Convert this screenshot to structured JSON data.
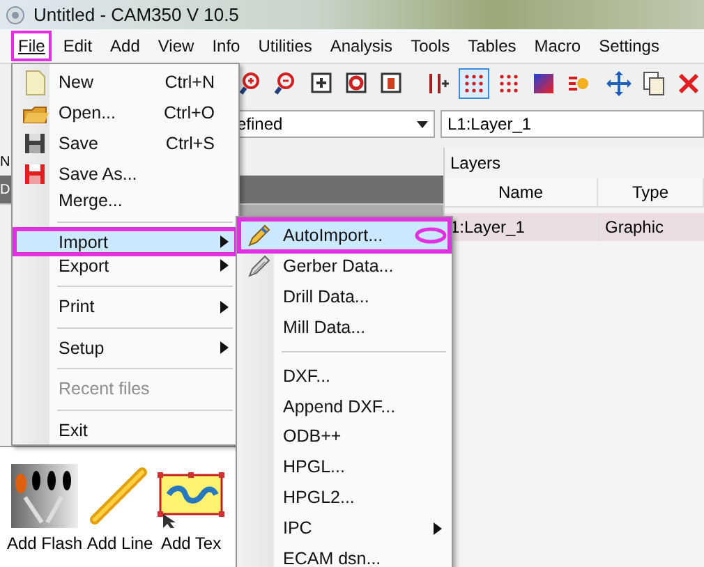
{
  "window": {
    "title": "Untitled - CAM350 V 10.5"
  },
  "menubar": [
    {
      "label": "File",
      "selected": true,
      "highlighted": true
    },
    {
      "label": "Edit",
      "selected": false,
      "highlighted": false
    },
    {
      "label": "Add",
      "selected": false,
      "highlighted": false
    },
    {
      "label": "View",
      "selected": false,
      "highlighted": false
    },
    {
      "label": "Info",
      "selected": false,
      "highlighted": false
    },
    {
      "label": "Utilities",
      "selected": false,
      "highlighted": false
    },
    {
      "label": "Analysis",
      "selected": false,
      "highlighted": false
    },
    {
      "label": "Tools",
      "selected": false,
      "highlighted": false
    },
    {
      "label": "Tables",
      "selected": false,
      "highlighted": false
    },
    {
      "label": "Macro",
      "selected": false,
      "highlighted": false
    },
    {
      "label": "Settings",
      "selected": false,
      "highlighted": false
    }
  ],
  "toolbar": [
    {
      "kind": "zoom-in",
      "selected": false
    },
    {
      "kind": "zoom-out",
      "selected": false
    },
    {
      "kind": "zoom-box",
      "selected": false
    },
    {
      "kind": "zoom-red",
      "selected": false
    },
    {
      "kind": "zoom-page",
      "selected": false
    },
    {
      "kind": "separator"
    },
    {
      "kind": "snap",
      "selected": false
    },
    {
      "kind": "grid",
      "selected": true
    },
    {
      "kind": "grid",
      "selected": false
    },
    {
      "kind": "color",
      "selected": false
    },
    {
      "kind": "dots",
      "selected": false
    },
    {
      "kind": "gap"
    },
    {
      "kind": "move",
      "selected": false
    },
    {
      "kind": "copy",
      "selected": false
    },
    {
      "kind": "delete",
      "selected": false
    }
  ],
  "layer_combo": {
    "value": "efined"
  },
  "layer_select": {
    "value": "L1:Layer_1"
  },
  "left_panel": {
    "label": "N",
    "header": "D"
  },
  "layers": {
    "title": "Layers",
    "columns": [
      "Name",
      "Type"
    ],
    "rows": [
      {
        "name": "1:Layer_1",
        "type": "Graphic",
        "selected": true
      }
    ]
  },
  "file_menu": [
    {
      "kind": "item",
      "label": "New",
      "shortcut": "Ctrl+N",
      "disabled": false,
      "selected": false,
      "submenu": false,
      "highlighted": false
    },
    {
      "kind": "item",
      "label": "Open...",
      "shortcut": "Ctrl+O",
      "disabled": false,
      "selected": false,
      "submenu": false,
      "highlighted": false
    },
    {
      "kind": "item",
      "label": "Save",
      "shortcut": "Ctrl+S",
      "disabled": false,
      "selected": false,
      "submenu": false,
      "highlighted": false
    },
    {
      "kind": "item",
      "label": "Save As...",
      "disabled": false,
      "selected": false,
      "submenu": false,
      "highlighted": false
    },
    {
      "kind": "item",
      "label": "Merge...",
      "disabled": false,
      "selected": false,
      "submenu": false,
      "highlighted": false
    },
    {
      "kind": "separator"
    },
    {
      "kind": "item",
      "label": "Import",
      "disabled": false,
      "selected": true,
      "submenu": true,
      "highlighted": true
    },
    {
      "kind": "item",
      "label": "Export",
      "disabled": false,
      "selected": false,
      "submenu": true,
      "highlighted": false
    },
    {
      "kind": "separator"
    },
    {
      "kind": "item",
      "label": "Print",
      "disabled": false,
      "selected": false,
      "submenu": true,
      "highlighted": false
    },
    {
      "kind": "separator"
    },
    {
      "kind": "item",
      "label": "Setup",
      "disabled": false,
      "selected": false,
      "submenu": true,
      "highlighted": false
    },
    {
      "kind": "separator"
    },
    {
      "kind": "item",
      "label": "Recent files",
      "disabled": true,
      "selected": false,
      "submenu": false,
      "highlighted": false
    },
    {
      "kind": "separator"
    },
    {
      "kind": "item",
      "label": "Exit",
      "disabled": false,
      "selected": false,
      "submenu": false,
      "highlighted": false
    }
  ],
  "import_menu": [
    {
      "kind": "item",
      "label": "AutoImport...",
      "disabled": false,
      "selected": true,
      "submenu": false,
      "highlighted": true
    },
    {
      "kind": "item",
      "label": "Gerber Data...",
      "disabled": false,
      "selected": false,
      "submenu": false,
      "highlighted": false
    },
    {
      "kind": "item",
      "label": "Drill Data...",
      "disabled": false,
      "selected": false,
      "submenu": false,
      "highlighted": false
    },
    {
      "kind": "item",
      "label": "Mill Data...",
      "disabled": false,
      "selected": false,
      "submenu": false,
      "highlighted": false
    },
    {
      "kind": "separator"
    },
    {
      "kind": "item",
      "label": "DXF...",
      "disabled": false,
      "selected": false,
      "submenu": false,
      "highlighted": false
    },
    {
      "kind": "item",
      "label": "Append DXF...",
      "disabled": false,
      "selected": false,
      "submenu": false,
      "highlighted": false
    },
    {
      "kind": "item",
      "label": "ODB++",
      "disabled": false,
      "selected": false,
      "submenu": false,
      "highlighted": false
    },
    {
      "kind": "item",
      "label": "HPGL...",
      "disabled": false,
      "selected": false,
      "submenu": false,
      "highlighted": false
    },
    {
      "kind": "item",
      "label": "HPGL2...",
      "disabled": false,
      "selected": false,
      "submenu": false,
      "highlighted": false
    },
    {
      "kind": "item",
      "label": "IPC",
      "disabled": false,
      "selected": false,
      "submenu": true,
      "highlighted": false
    },
    {
      "kind": "item",
      "label": "ECAM dsn...",
      "disabled": false,
      "selected": false,
      "submenu": false,
      "highlighted": false
    }
  ],
  "tools": [
    {
      "label": "Add Flash"
    },
    {
      "label": "Add Line"
    },
    {
      "label": "Add Tex"
    }
  ]
}
